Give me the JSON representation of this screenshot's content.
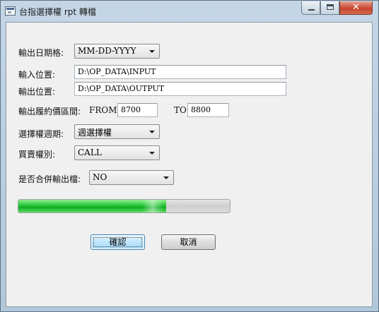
{
  "window": {
    "title": "台指選擇權 rpt 轉檔",
    "minimize_icon": "minimize-icon",
    "maximize_icon": "maximize-icon",
    "close_icon": "close-icon",
    "close_glyph": "✕"
  },
  "form": {
    "output_date_format": {
      "label": "輸出日期格:",
      "value": "MM-DD-YYYY"
    },
    "input_location": {
      "label": "輸入位置:",
      "value": "D:\\OP_DATA\\INPUT"
    },
    "output_location": {
      "label": "輸出位置:",
      "value": "D:\\OP_DATA\\OUTPUT"
    },
    "strike_range": {
      "label": "輸出履約價區間:",
      "from_label": "FROM",
      "from_value": "8700",
      "to_label": "TO",
      "to_value": "8800"
    },
    "option_period": {
      "label": "選擇權週期:",
      "value": "週選擇權"
    },
    "call_put": {
      "label": "買賣權別:",
      "value": "CALL"
    },
    "merge_output": {
      "label": "是否合併輸出檔:",
      "value": "NO"
    }
  },
  "progress": {
    "fraction": 0.7
  },
  "buttons": {
    "ok": "確認",
    "cancel": "取消"
  }
}
